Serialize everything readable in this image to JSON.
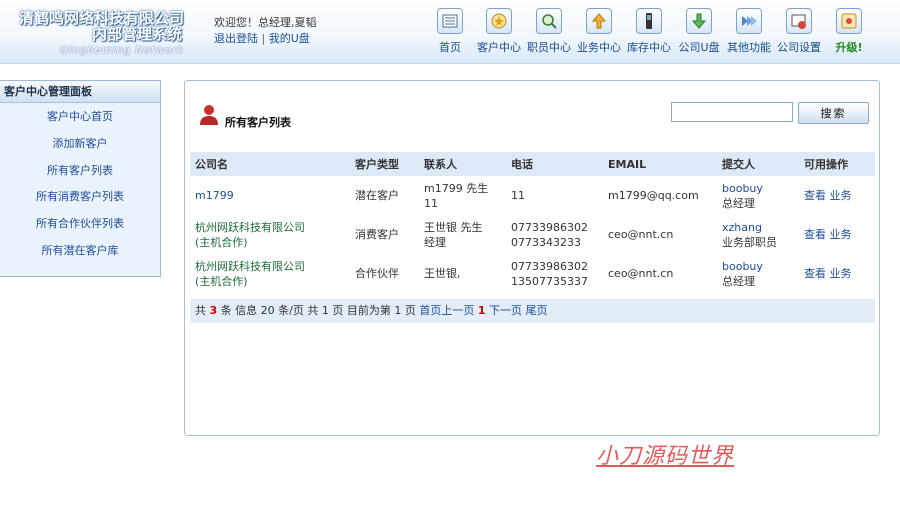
{
  "header": {
    "logo_line1": "清鹤鸣网络科技有限公司",
    "logo_line2": "内部管理系统",
    "logo_line3": "Qingheming Network",
    "welcome_text": "欢迎您！总经理,夏韬",
    "logout_link": "退出登陆",
    "separator": "|",
    "my_udisk_link": "我的U盘"
  },
  "topnav": {
    "items": [
      {
        "label": "首页",
        "icon": "home-icon"
      },
      {
        "label": "客户中心",
        "icon": "star-icon"
      },
      {
        "label": "职员中心",
        "icon": "magnifier-icon"
      },
      {
        "label": "业务中心",
        "icon": "upload-icon"
      },
      {
        "label": "库存中心",
        "icon": "device-icon"
      },
      {
        "label": "公司U盘",
        "icon": "download-icon"
      },
      {
        "label": "其他功能",
        "icon": "arrows-icon"
      },
      {
        "label": "公司设置",
        "icon": "settings-icon"
      },
      {
        "label": "升级!",
        "icon": "upgrade-icon"
      }
    ]
  },
  "sidebar": {
    "title": "客户中心管理面板",
    "items": [
      {
        "label": "客户中心首页"
      },
      {
        "label": "添加新客户"
      },
      {
        "label": "所有客户列表"
      },
      {
        "label": "所有消费客户列表"
      },
      {
        "label": "所有合作伙伴列表"
      },
      {
        "label": "所有潜在客户库"
      }
    ]
  },
  "main": {
    "title": "所有客户列表",
    "search": {
      "value": "",
      "button_label": "搜索"
    },
    "columns": [
      "公司名",
      "客户类型",
      "联系人",
      "电话",
      "EMAIL",
      "提交人",
      "可用操作"
    ],
    "rows": [
      {
        "company": "m1799",
        "company2": "",
        "type": "潜在客户",
        "contact1": "m1799 先生",
        "contact2": "11",
        "phone1": "11",
        "phone2": "",
        "email": "m1799@qq.com",
        "submitter": "boobuy",
        "submitter_role": "总经理",
        "view": "查看",
        "business": "业务"
      },
      {
        "company": "杭州网跃科技有限公司",
        "company2": "(主机合作)",
        "type": "消费客户",
        "contact1": "王世银 先生",
        "contact2": "经理",
        "phone1": "07733986302",
        "phone2": "0773343233",
        "email": "ceo@nnt.cn",
        "submitter": "xzhang",
        "submitter_role": "业务部职员",
        "view": "查看",
        "business": "业务"
      },
      {
        "company": "杭州网跃科技有限公司",
        "company2": "(主机合作)",
        "type": "合作伙伴",
        "contact1": "王世银,",
        "contact2": "",
        "phone1": "07733986302",
        "phone2": "13507735337",
        "email": "ceo@nnt.cn",
        "submitter": "boobuy",
        "submitter_role": "总经理",
        "view": "查看",
        "business": "业务"
      }
    ],
    "pager": {
      "prefix": "共",
      "total": "3",
      "mid1": "条 信息 20 条/页 共 1 页 目前为第 1 页",
      "first": "首页",
      "prev": "上一页",
      "current": "1",
      "next": "下一页",
      "last": "尾页"
    }
  },
  "watermark": "小刀源码世界",
  "colors": {
    "accent": "#1e4d9a",
    "panel_bg": "#eaf2fb",
    "header_row": "#dde9f6",
    "watermark": "#e35a5a"
  }
}
